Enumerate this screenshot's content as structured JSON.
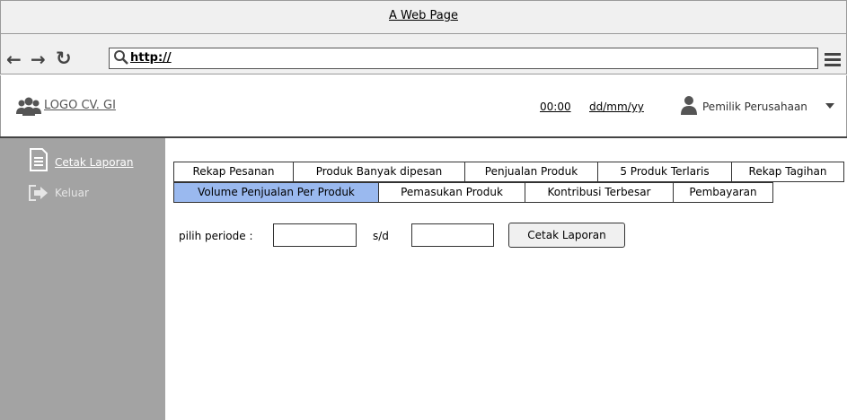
{
  "window": {
    "title": "A Web Page"
  },
  "browser": {
    "url": "http://",
    "nav_icons": [
      "back-arrow-icon",
      "forward-arrow-icon",
      "reload-icon",
      "search-icon",
      "menu-icon"
    ]
  },
  "header": {
    "logo_text": "LOGO CV. GI",
    "time": "00:00",
    "date": "dd/mm/yy",
    "user_name": "Pemilik Perusahaan",
    "icons": [
      "users-icon",
      "user-icon",
      "caret-down-icon"
    ]
  },
  "sidebar": {
    "items": [
      {
        "label": "Cetak Laporan",
        "icon": "document-icon",
        "active": true
      },
      {
        "label": "Keluar",
        "icon": "exit-icon",
        "active": false
      }
    ]
  },
  "tabs": {
    "row1": [
      "Rekap Pesanan",
      "Produk Banyak dipesan",
      "Penjualan Produk",
      "5 Produk Terlaris",
      "Rekap Tagihan"
    ],
    "row2": [
      "Volume Penjualan Per Produk",
      "Pemasukan Produk",
      "Kontribusi Terbesar",
      "Pembayaran"
    ],
    "active": "Volume Penjualan Per Produk"
  },
  "content": {
    "period_label": "pilih periode :",
    "separator": "s/d",
    "from_value": "",
    "to_value": "",
    "print_button": "Cetak Laporan"
  },
  "colors": {
    "sidebar_bg": "#a3a3a3",
    "active_tab": "#9ab9ef",
    "chrome_bg": "#f0f0f0"
  }
}
